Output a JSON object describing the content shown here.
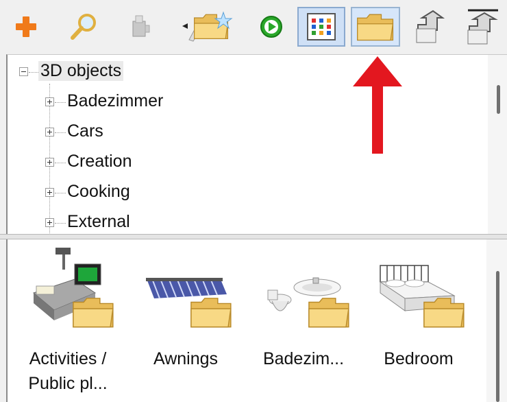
{
  "toolbar": {
    "buttons": [
      {
        "name": "add",
        "icon": "plus-icon",
        "pressed": false
      },
      {
        "name": "search",
        "icon": "magnifier-icon",
        "pressed": false
      },
      {
        "name": "tools",
        "icon": "tools-icon",
        "pressed": false
      },
      {
        "name": "import",
        "icon": "import-folder-star-icon",
        "pressed": false
      },
      {
        "name": "play",
        "icon": "play-icon",
        "pressed": false
      },
      {
        "name": "grid-view",
        "icon": "grid-view-icon",
        "pressed": true
      },
      {
        "name": "folders",
        "icon": "folder-icon",
        "pressed": true
      },
      {
        "name": "up",
        "icon": "up-arrow-icon",
        "pressed": false
      },
      {
        "name": "top",
        "icon": "top-arrow-icon",
        "pressed": false
      }
    ]
  },
  "tree": {
    "root": "3D objects",
    "children": [
      "Badezimmer",
      "Cars",
      "Creation",
      "Cooking",
      "External"
    ]
  },
  "items": [
    {
      "label_line1": "Activities /",
      "label_line2": "Public pl...",
      "icon": "cash-register-folder-icon"
    },
    {
      "label_line1": "Awnings",
      "label_line2": "",
      "icon": "awning-folder-icon"
    },
    {
      "label_line1": "Badezim...",
      "label_line2": "",
      "icon": "bathroom-folder-icon"
    },
    {
      "label_line1": "Bedroom",
      "label_line2": "",
      "icon": "bed-folder-icon"
    }
  ],
  "annotation": {
    "color": "#e3171f",
    "icon": "red-arrow-icon"
  },
  "colors": {
    "folder": "#f7d57a",
    "folder_dark": "#d7a83a",
    "accent_plus": "#f07a1a",
    "play_green": "#2aa82a"
  }
}
